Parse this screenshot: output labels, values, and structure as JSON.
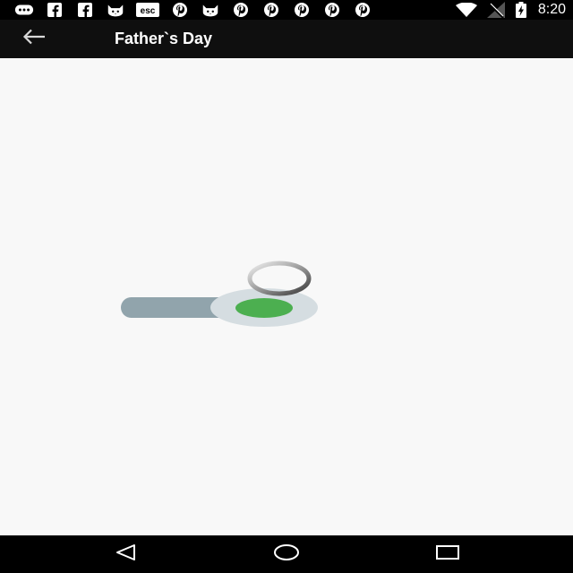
{
  "status_bar": {
    "notification_icons": [
      "messages-icon",
      "facebook-icon",
      "facebook-icon",
      "cat-icon",
      "esc-icon",
      "pinterest-icon",
      "cat-icon",
      "pinterest-icon",
      "pinterest-icon",
      "pinterest-icon",
      "pinterest-icon",
      "pinterest-icon"
    ],
    "esc_label": "esc",
    "time": "8:20"
  },
  "app_bar": {
    "title": "Father`s Day",
    "back_icon": "arrow-back-icon"
  },
  "content": {
    "toggle_state": "on",
    "toggle_color": "#4caf50",
    "loading": true
  },
  "nav_bar": {
    "icons": [
      "back-triangle-icon",
      "home-circle-icon",
      "recents-square-icon"
    ]
  }
}
